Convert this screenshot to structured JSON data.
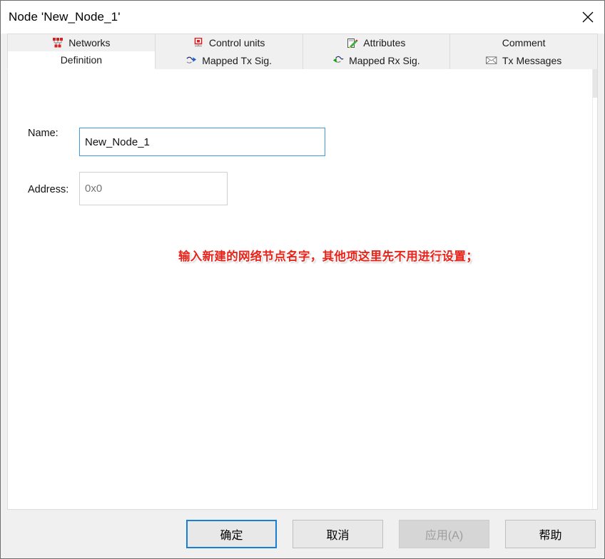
{
  "window": {
    "title": "Node 'New_Node_1'",
    "close_icon": "close-icon"
  },
  "tabs": {
    "row1": [
      {
        "label": "Networks",
        "icon": "network-topology-icon",
        "active": false
      },
      {
        "label": "Control units",
        "icon": "control-unit-icon",
        "active": false
      },
      {
        "label": "Attributes",
        "icon": "pencil-notepad-icon",
        "active": false
      },
      {
        "label": "Comment",
        "icon": "",
        "active": false
      }
    ],
    "row2": [
      {
        "label": "Definition",
        "icon": "",
        "active": true
      },
      {
        "label": "Mapped Tx Sig.",
        "icon": "tx-signal-icon",
        "active": false
      },
      {
        "label": "Mapped Rx Sig.",
        "icon": "rx-signal-icon",
        "active": false
      },
      {
        "label": "Tx Messages",
        "icon": "envelope-icon",
        "active": false
      }
    ]
  },
  "form": {
    "name": {
      "label": "Name:",
      "value": "New_Node_1",
      "placeholder": ""
    },
    "address": {
      "label": "Address:",
      "value": "",
      "placeholder": "0x0"
    }
  },
  "annotation": {
    "text": "输入新建的网络节点名字，其他项这里先不用进行设置；",
    "color": "#e8231a"
  },
  "buttons": {
    "ok": "确定",
    "cancel": "取消",
    "apply": "应用(A)",
    "help": "帮助"
  },
  "colors": {
    "focus_border": "#1a7fd4",
    "dialog_bg": "#f0f0f0",
    "panel_bg": "#ffffff",
    "annotation_red": "#e8231a"
  }
}
